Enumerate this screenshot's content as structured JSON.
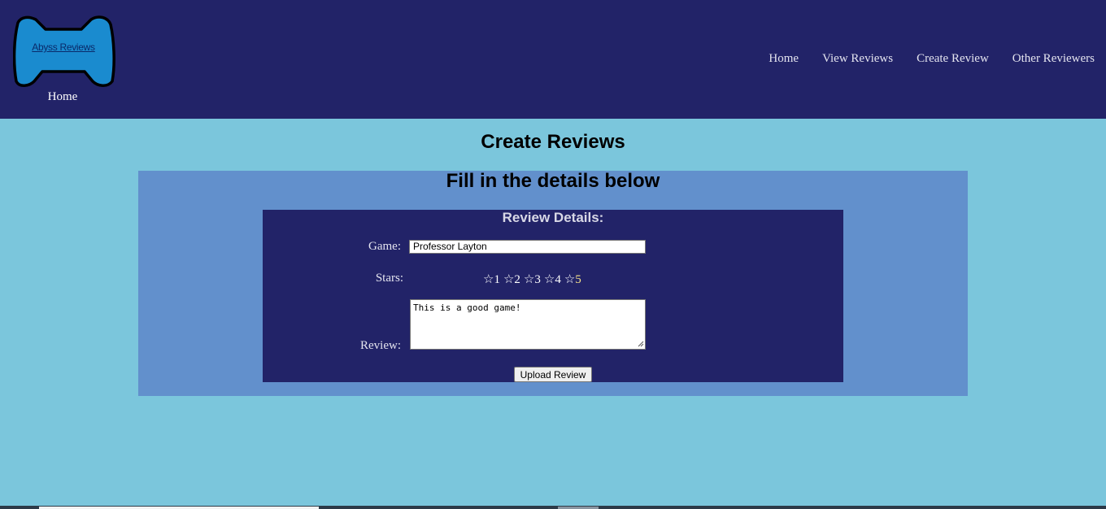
{
  "header": {
    "logo_text": "Abyss Reviews",
    "logo_caption": "Home",
    "nav": [
      "Home",
      "View Reviews",
      "Create Review",
      "Other Reviewers"
    ]
  },
  "page": {
    "title": "Create Reviews",
    "panel_title": "Fill in the details below"
  },
  "form": {
    "heading": "Review Details:",
    "game_label": "Game:",
    "game_value": "Professor Layton",
    "stars_label": "Stars:",
    "star_glyph": "☆",
    "stars": [
      "1",
      "2",
      "3",
      "4",
      "5"
    ],
    "selected_star": 5,
    "review_label": "Review:",
    "review_value": "This is a good game!",
    "submit_label": "Upload Review"
  },
  "colors": {
    "header_bg": "#222368",
    "page_bg": "#7bc6dc",
    "panel_bg": "#6290cc",
    "form_bg": "#222368",
    "logo_fill": "#1a8bcf",
    "selected_star": "#f7e28a"
  },
  "icons": {
    "logo": "gamepad-logo-icon",
    "star": "star-outline-icon"
  }
}
